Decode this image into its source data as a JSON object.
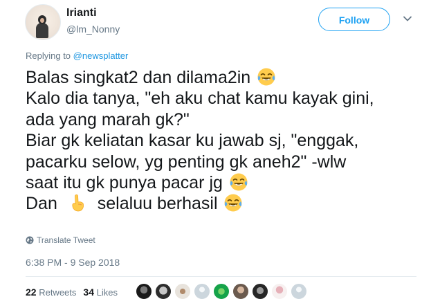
{
  "tweet": {
    "display_name": "Irianti",
    "handle": "@lm_Nonny",
    "follow_label": "Follow",
    "reply_prefix": "Replying to",
    "reply_mention": "@newsplatter",
    "lines": [
      "Balas singkat2 dan dilama2in",
      "Kalo dia tanya, \"eh aku chat kamu kayak gini,",
      "ada yang marah gk?\"",
      "Biar gk keliatan kasar ku jawab sj, \"enggak,",
      "pacarku selow, yg penting gk aneh2\" -wlw",
      "saat itu gk punya pacar jg",
      "Dan",
      "selaluu berhasil"
    ],
    "translate_label": "Translate Tweet",
    "timestamp": "6:38 PM - 9 Sep 2018",
    "retweets_count": "22",
    "retweets_label": "Retweets",
    "likes_count": "34",
    "likes_label": "Likes"
  },
  "icons": {
    "emoji_laugh": "face-with-tears-of-joy-icon",
    "emoji_point": "backhand-index-pointing-up-icon",
    "globe": "globe-icon",
    "caret": "chevron-down-icon"
  },
  "colors": {
    "accent": "#1da1f2",
    "link": "#1b95e0",
    "muted": "#657786",
    "text": "#14171a"
  }
}
